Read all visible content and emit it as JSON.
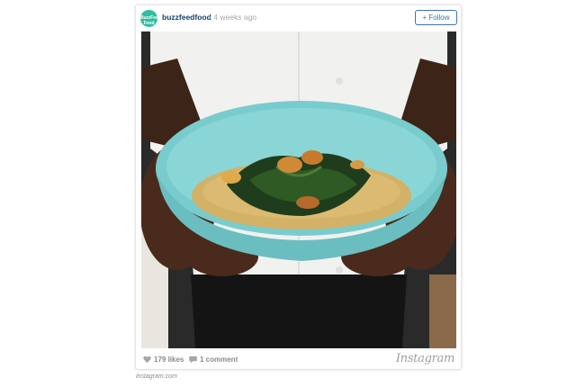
{
  "post": {
    "avatar_text": "BuzzFeed Food",
    "username": "buzzfeedfood",
    "timestamp": "• 4 weeks ago",
    "follow_label": "+ Follow",
    "likes": "179 likes",
    "comments": "1 comment",
    "logo_text": "Instagram"
  },
  "caption": {
    "source": "instagram.com"
  },
  "icons": {
    "avatar": "buzzfeed-food-logo",
    "like": "heart-icon",
    "comment": "speech-bubble-icon"
  },
  "colors": {
    "brand_teal": "#2fbe9f",
    "username": "#12406b",
    "follow": "#3b74b0",
    "bowl": "#7ccfd0",
    "polenta": "#d2b066"
  }
}
